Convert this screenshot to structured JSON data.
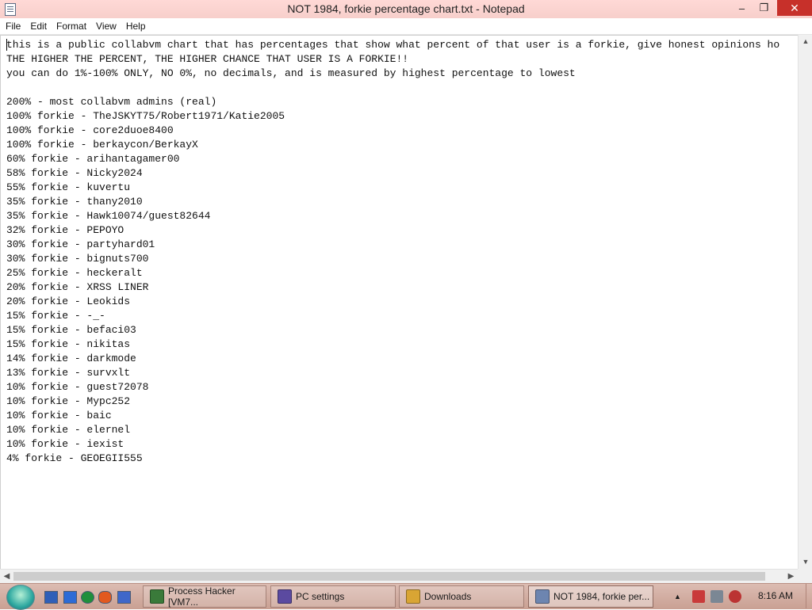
{
  "window": {
    "title": "NOT 1984, forkie percentage chart.txt - Notepad",
    "min_glyph": "–",
    "max_glyph": "❐",
    "close_glyph": "✕"
  },
  "menu": [
    "File",
    "Edit",
    "Format",
    "View",
    "Help"
  ],
  "document": {
    "lines": [
      "this is a public collabvm chart that has percentages that show what percent of that user is a forkie, give honest opinions ho",
      "THE HIGHER THE PERCENT, THE HIGHER CHANCE THAT USER IS A FORKIE!!",
      "you can do 1%-100% ONLY, NO 0%, no decimals, and is measured by highest percentage to lowest",
      "",
      "200% - most collabvm admins (real)",
      "100% forkie - TheJSKYT75/Robert1971/Katie2005",
      "100% forkie - core2duoe8400",
      "100% forkie - berkaycon/BerkayX",
      "60% forkie - arihantagamer00",
      "58% forkie - Nicky2024",
      "55% forkie - kuvertu",
      "35% forkie - thany2010",
      "35% forkie - Hawk10074/guest82644",
      "32% forkie - PEPOYO",
      "30% forkie - partyhard01",
      "30% forkie - bignuts700",
      "25% forkie - heckeralt",
      "20% forkie - XRSS LINER",
      "20% forkie - Leokids",
      "15% forkie - -_-",
      "15% forkie - befaci03",
      "15% forkie - nikitas",
      "14% forkie - darkmode",
      "13% forkie - survxlt",
      "10% forkie - guest72078",
      "10% forkie - Mypc252",
      "10% forkie - baic",
      "10% forkie - elernel",
      "10% forkie - iexist",
      "4% forkie - GEOEGII555"
    ]
  },
  "scroll": {
    "up": "▲",
    "down": "▼",
    "left": "◀",
    "right": "▶"
  },
  "taskbar": {
    "tasks": [
      {
        "label": "Process Hacker [VM7...",
        "icon_color": "#3a7a3a",
        "active": false
      },
      {
        "label": "PC settings",
        "icon_color": "#5b4aa0",
        "active": false
      },
      {
        "label": "Downloads",
        "icon_color": "#d9a534",
        "active": false
      },
      {
        "label": "NOT 1984, forkie per...",
        "icon_color": "#6d85b0",
        "active": true
      }
    ],
    "clock": "8:16 AM",
    "tray_up_arrow": "▲"
  },
  "colors": {
    "titlebar": "#ffd9d6",
    "close_button": "#c7302a",
    "taskbar": "#d4ad a1"
  }
}
